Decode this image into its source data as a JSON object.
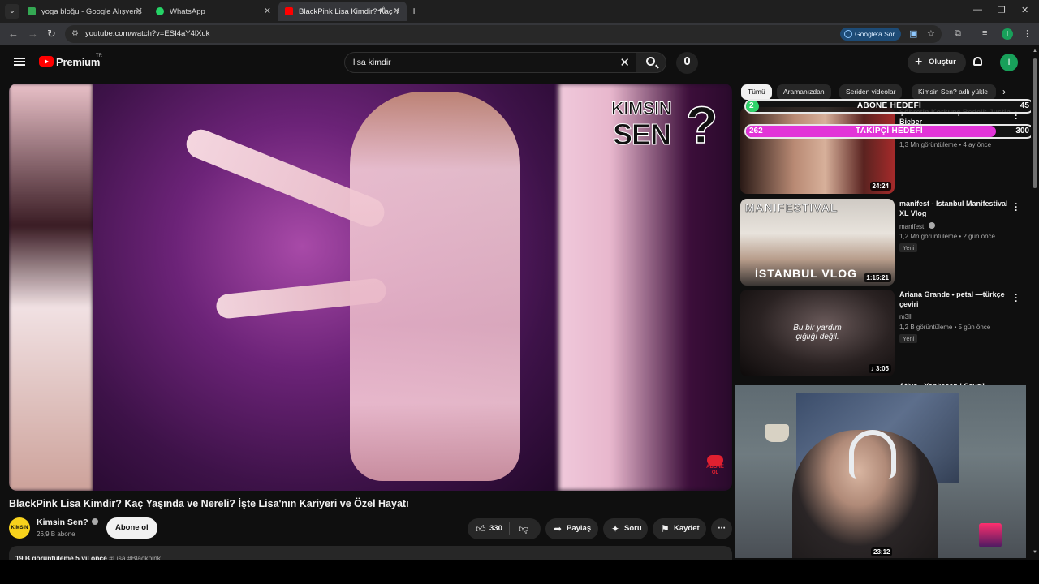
{
  "browser": {
    "tabs": [
      {
        "title": "yoga bloğu - Google Alışveriş",
        "favicon_color": "#34a853"
      },
      {
        "title": "WhatsApp",
        "favicon_color": "#25d366"
      },
      {
        "title": "BlackPink Lisa Kimdir? Kaç Y",
        "favicon_color": "#ff0000"
      }
    ],
    "url": "youtube.com/watch?v=ESI4aY4lXuk",
    "ask_google": "Google'a Sor",
    "profile_initial": "I"
  },
  "header": {
    "brand": "Premium",
    "region": "TR",
    "search_query": "lisa kimdir",
    "create_label": "Oluştur",
    "avatar_initial": "I"
  },
  "video": {
    "overlay_logo_line1": "KIMSIN",
    "overlay_logo_line2": "SEN",
    "overlay_badge": "ABONE OL",
    "title": "BlackPink Lisa Kimdir? Kaç Yaşında ve Nereli? İşte Lisa'nın Kariyeri ve Özel Hayatı",
    "channel_name": "Kimsin Sen?",
    "channel_avatar_text": "KIMSIN SEN?",
    "subscribers": "26,9 B abone",
    "subscribe_label": "Abone ol",
    "likes": "330",
    "share_label": "Paylaş",
    "ask_label": "Soru",
    "save_label": "Kaydet",
    "views_time": "19 B görüntüleme  5 yıl önce",
    "tags": "#Lisa #Blackpink"
  },
  "chips": [
    "Tümü",
    "Aramanızdan",
    "Seriden videolar",
    "Kimsin Sen? adlı yükle"
  ],
  "recommendations": [
    {
      "title": "Şöhretin Korkunç Bedeli: Justin Bieber",
      "channel": "",
      "views": "1,3 Mn görüntüleme • 4 ay önce",
      "duration": "24:24",
      "is_new": false
    },
    {
      "title": "manifest - İstanbul Manifestival XL Vlog",
      "channel": "manifest",
      "views": "1,2 Mn görüntüleme • 2 gün önce",
      "duration": "1:15:21",
      "is_new": true,
      "thumb_text_top": "MANIFESTIVAL",
      "thumb_text_bottom": "İSTANBUL VLOG"
    },
    {
      "title": "Ariana Grande • petal —türkçe çeviri",
      "channel": "m3ll",
      "views": "1,2 B görüntüleme • 5 gün önce",
      "duration": "3:05",
      "is_new": true,
      "thumb_text": "Bu bir yardım çığlığı değil."
    },
    {
      "title": "Ativo - Yankesen | Sayo1"
    }
  ],
  "new_badge": "Yeni",
  "goals": {
    "subscriber_goal": {
      "label": "ABONE HEDEFİ",
      "current": "2",
      "target": "45",
      "progress": 0.044,
      "color": "#2fd36a"
    },
    "follower_goal": {
      "label": "TAKİPÇİ HEDEFİ",
      "current": "262",
      "target": "300",
      "progress": 0.873,
      "color": "#e234d8"
    }
  },
  "webcam_duration": "23:12"
}
